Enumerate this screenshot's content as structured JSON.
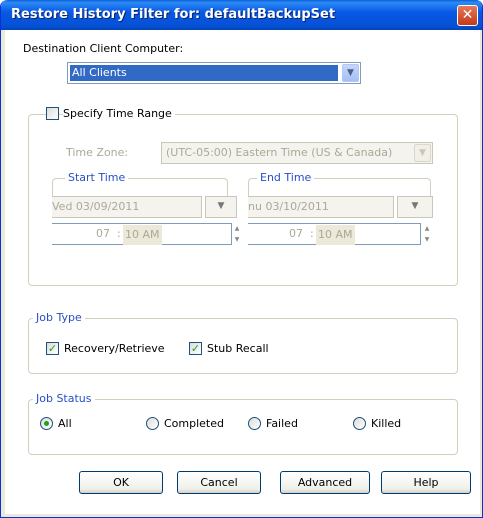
{
  "window": {
    "title": "Restore History Filter for:  defaultBackupSet",
    "close_glyph": "✕"
  },
  "destination": {
    "label": "Destination Client Computer:",
    "selected": "All Clients"
  },
  "time_range": {
    "checkbox_label": "Specify Time Range",
    "checked": false,
    "timezone_label": "Time Zone:",
    "timezone_value": "(UTC-05:00) Eastern Time (US & Canada)",
    "start": {
      "title": "Start Time",
      "date": "Ved 03/09/2011",
      "hour": "07",
      "sep": ":",
      "minute_ampm": "10 AM"
    },
    "end": {
      "title": "End Time",
      "date": "nu 03/10/2011",
      "hour": "07",
      "sep": ":",
      "minute_ampm": "10 AM"
    }
  },
  "job_type": {
    "title": "Job Type",
    "options": [
      {
        "label": "Recovery/Retrieve",
        "checked": true
      },
      {
        "label": "Stub Recall",
        "checked": true
      }
    ]
  },
  "job_status": {
    "title": "Job Status",
    "options": [
      {
        "label": "All",
        "selected": true
      },
      {
        "label": "Completed",
        "selected": false
      },
      {
        "label": "Failed",
        "selected": false
      },
      {
        "label": "Killed",
        "selected": false
      }
    ]
  },
  "buttons": {
    "ok": "OK",
    "cancel": "Cancel",
    "advanced": "Advanced",
    "help": "Help"
  },
  "icons": {
    "check": "✓",
    "dropdown": "▼"
  },
  "colors": {
    "titlebar": "#0859e6",
    "selection": "#316ac5",
    "check": "#21a121",
    "group_title": "#2650c8",
    "disabled": "#aca899"
  }
}
